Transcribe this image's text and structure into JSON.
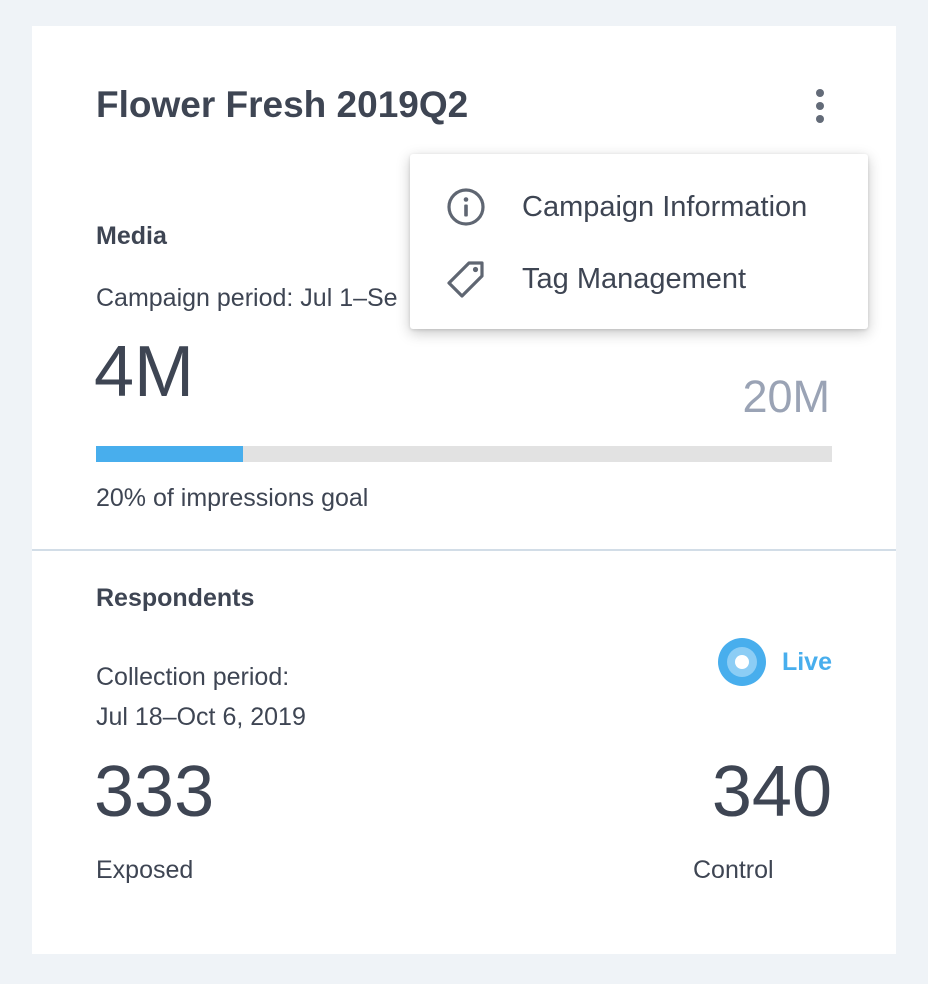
{
  "card": {
    "title": "Flower Fresh 2019Q2"
  },
  "media": {
    "label": "Media",
    "campaign_period": "Campaign period: Jul 1–Se",
    "impressions": "4M",
    "goal": "20M",
    "progress_fraction": 0.2,
    "progress_caption": "20% of impressions goal",
    "progress_color": "#48aeed"
  },
  "respondents": {
    "label": "Respondents",
    "collection_label": "Collection period:",
    "collection_dates": "Jul 18–Oct 6, 2019",
    "status": "Live",
    "status_color": "#48aeed",
    "exposed_value": "333",
    "exposed_label": "Exposed",
    "control_value": "340",
    "control_label": "Control"
  },
  "menu": {
    "items": [
      {
        "label": "Campaign Information",
        "icon": "info-icon"
      },
      {
        "label": "Tag Management",
        "icon": "tag-icon"
      }
    ]
  }
}
